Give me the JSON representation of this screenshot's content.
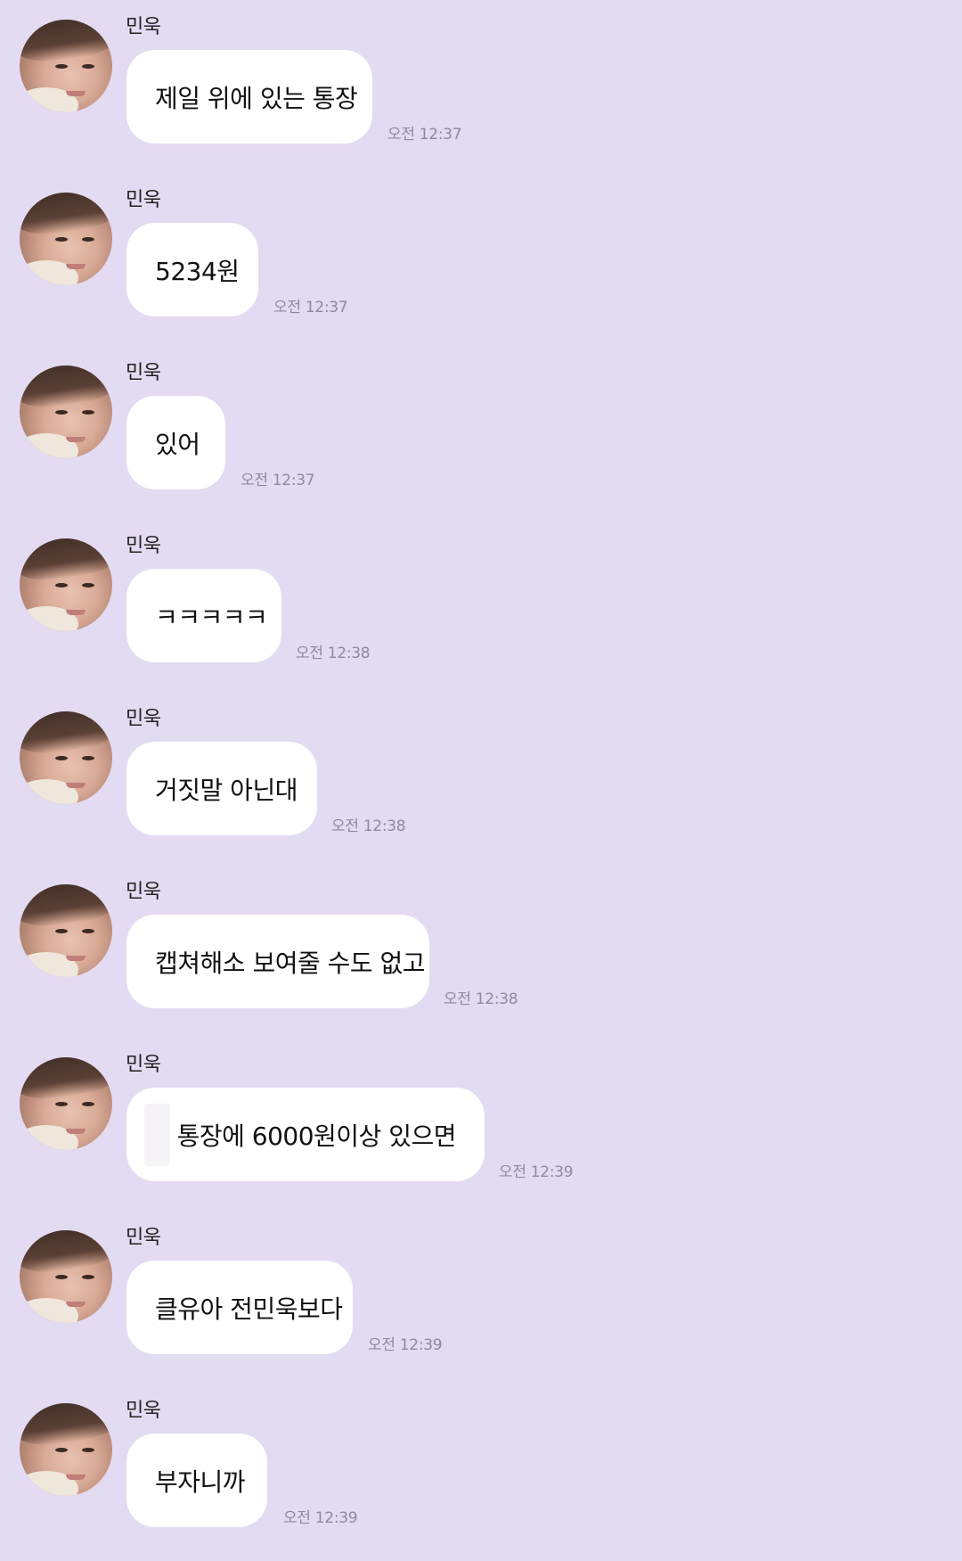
{
  "messages": [
    {
      "sender": "민욱",
      "text": "제일 위에 있는 통장",
      "time": "오전 12:37"
    },
    {
      "sender": "민욱",
      "text": "5234원",
      "time": "오전 12:37"
    },
    {
      "sender": "민욱",
      "text": "있어",
      "time": "오전 12:37"
    },
    {
      "sender": "민욱",
      "text": "ㅋㅋㅋㅋㅋ",
      "time": "오전 12:38"
    },
    {
      "sender": "민욱",
      "text": "거짓말 아닌대",
      "time": "오전 12:38"
    },
    {
      "sender": "민욱",
      "text": "캡쳐해소 보여줄 수도 없고",
      "time": "오전 12:38"
    },
    {
      "sender": "민욱",
      "text": "통장에 6000원이상 있으면",
      "time": "오전 12:39"
    },
    {
      "sender": "민욱",
      "text": "클유아 전민욱보다",
      "time": "오전 12:39"
    },
    {
      "sender": "민욱",
      "text": "부자니까",
      "time": "오전 12:39"
    }
  ],
  "colors": {
    "background": "#e3dbf2",
    "bubble": "#ffffff",
    "time": "#8f8a99"
  }
}
